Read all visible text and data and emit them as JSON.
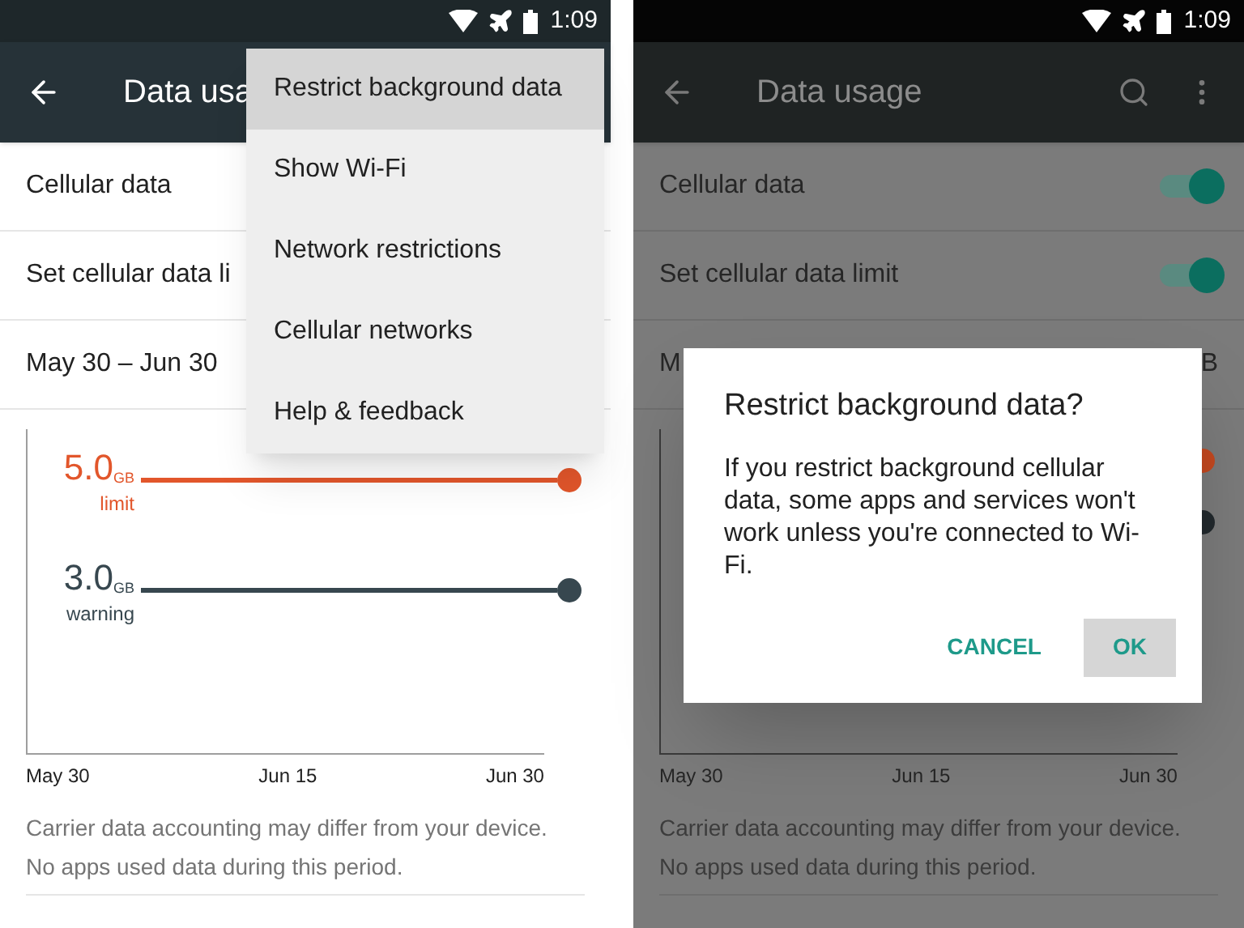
{
  "left_screen": {
    "status_bar": {
      "time": "1:09"
    },
    "app_bar": {
      "title": "Data usa"
    },
    "rows": [
      {
        "label": "Cellular data"
      },
      {
        "label": "Set cellular data li"
      },
      {
        "label": "May 30 – Jun 30"
      }
    ],
    "chart": {
      "thresholds": [
        {
          "value": "5.0",
          "unit": "GB",
          "caption": "limit",
          "color": "#e2562b"
        },
        {
          "value": "3.0",
          "unit": "GB",
          "caption": "warning",
          "color": "#37474f"
        }
      ],
      "x_labels": [
        "May 30",
        "Jun 15",
        "Jun 30"
      ]
    },
    "notes": [
      "Carrier data accounting may differ from your device.",
      "No apps used data during this period."
    ],
    "menu": {
      "items": [
        {
          "label": "Restrict background data",
          "selected": true
        },
        {
          "label": "Show Wi-Fi",
          "selected": false
        },
        {
          "label": "Network restrictions",
          "selected": false
        },
        {
          "label": "Cellular networks",
          "selected": false
        },
        {
          "label": "Help & feedback",
          "selected": false
        }
      ]
    }
  },
  "right_screen": {
    "status_bar": {
      "time": "1:09"
    },
    "app_bar": {
      "title": "Data usage"
    },
    "rows": [
      {
        "kind": "toggle",
        "label": "Cellular data",
        "on": true
      },
      {
        "kind": "toggle",
        "label": "Set cellular data limit",
        "on": true
      },
      {
        "kind": "split",
        "label": "M",
        "value": "B"
      }
    ],
    "chart": {
      "thresholds": [
        {
          "color": "#c4481f"
        },
        {
          "color": "#22292d"
        }
      ],
      "x_labels": [
        "May 30",
        "Jun 15",
        "Jun 30"
      ]
    },
    "notes": [
      "Carrier data accounting may differ from your device.",
      "No apps used data during this period."
    ],
    "dialog": {
      "title": "Restrict background data?",
      "message": "If you restrict background cellular data, some apps and services won't work unless you're connected to Wi-Fi.",
      "buttons": [
        {
          "label": "CANCEL",
          "selected": false
        },
        {
          "label": "OK",
          "selected": true
        }
      ]
    }
  }
}
